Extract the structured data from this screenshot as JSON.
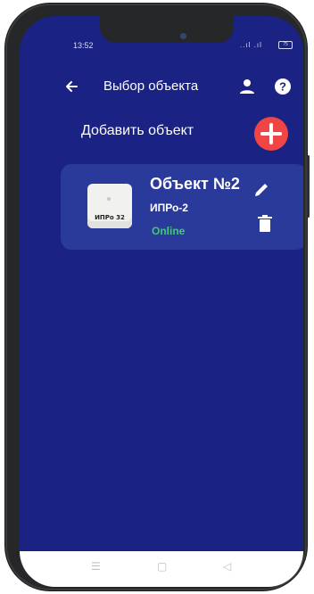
{
  "status_bar": {
    "time": "13:52",
    "signal": "..ıl .ıl",
    "battery": "75"
  },
  "topbar": {
    "title": "Выбор объекта",
    "back_icon": "arrow-left-icon",
    "user_icon": "user-icon",
    "help_icon": "help-circle-icon"
  },
  "add": {
    "label": "Добавить объект",
    "icon": "plus-circle-icon"
  },
  "objects": [
    {
      "name": "Объект №2",
      "type": "ИПРо-2",
      "status": "Online",
      "device_label": "ИПРо 32",
      "status_color": "#3ccf6a"
    }
  ],
  "nav": {
    "menu_icon": "menu-icon",
    "home_icon": "home-icon",
    "back_icon": "back-triangle-icon"
  },
  "colors": {
    "background": "#1a2283",
    "card": "#2a3a9a",
    "accent_red": "#f04545"
  }
}
